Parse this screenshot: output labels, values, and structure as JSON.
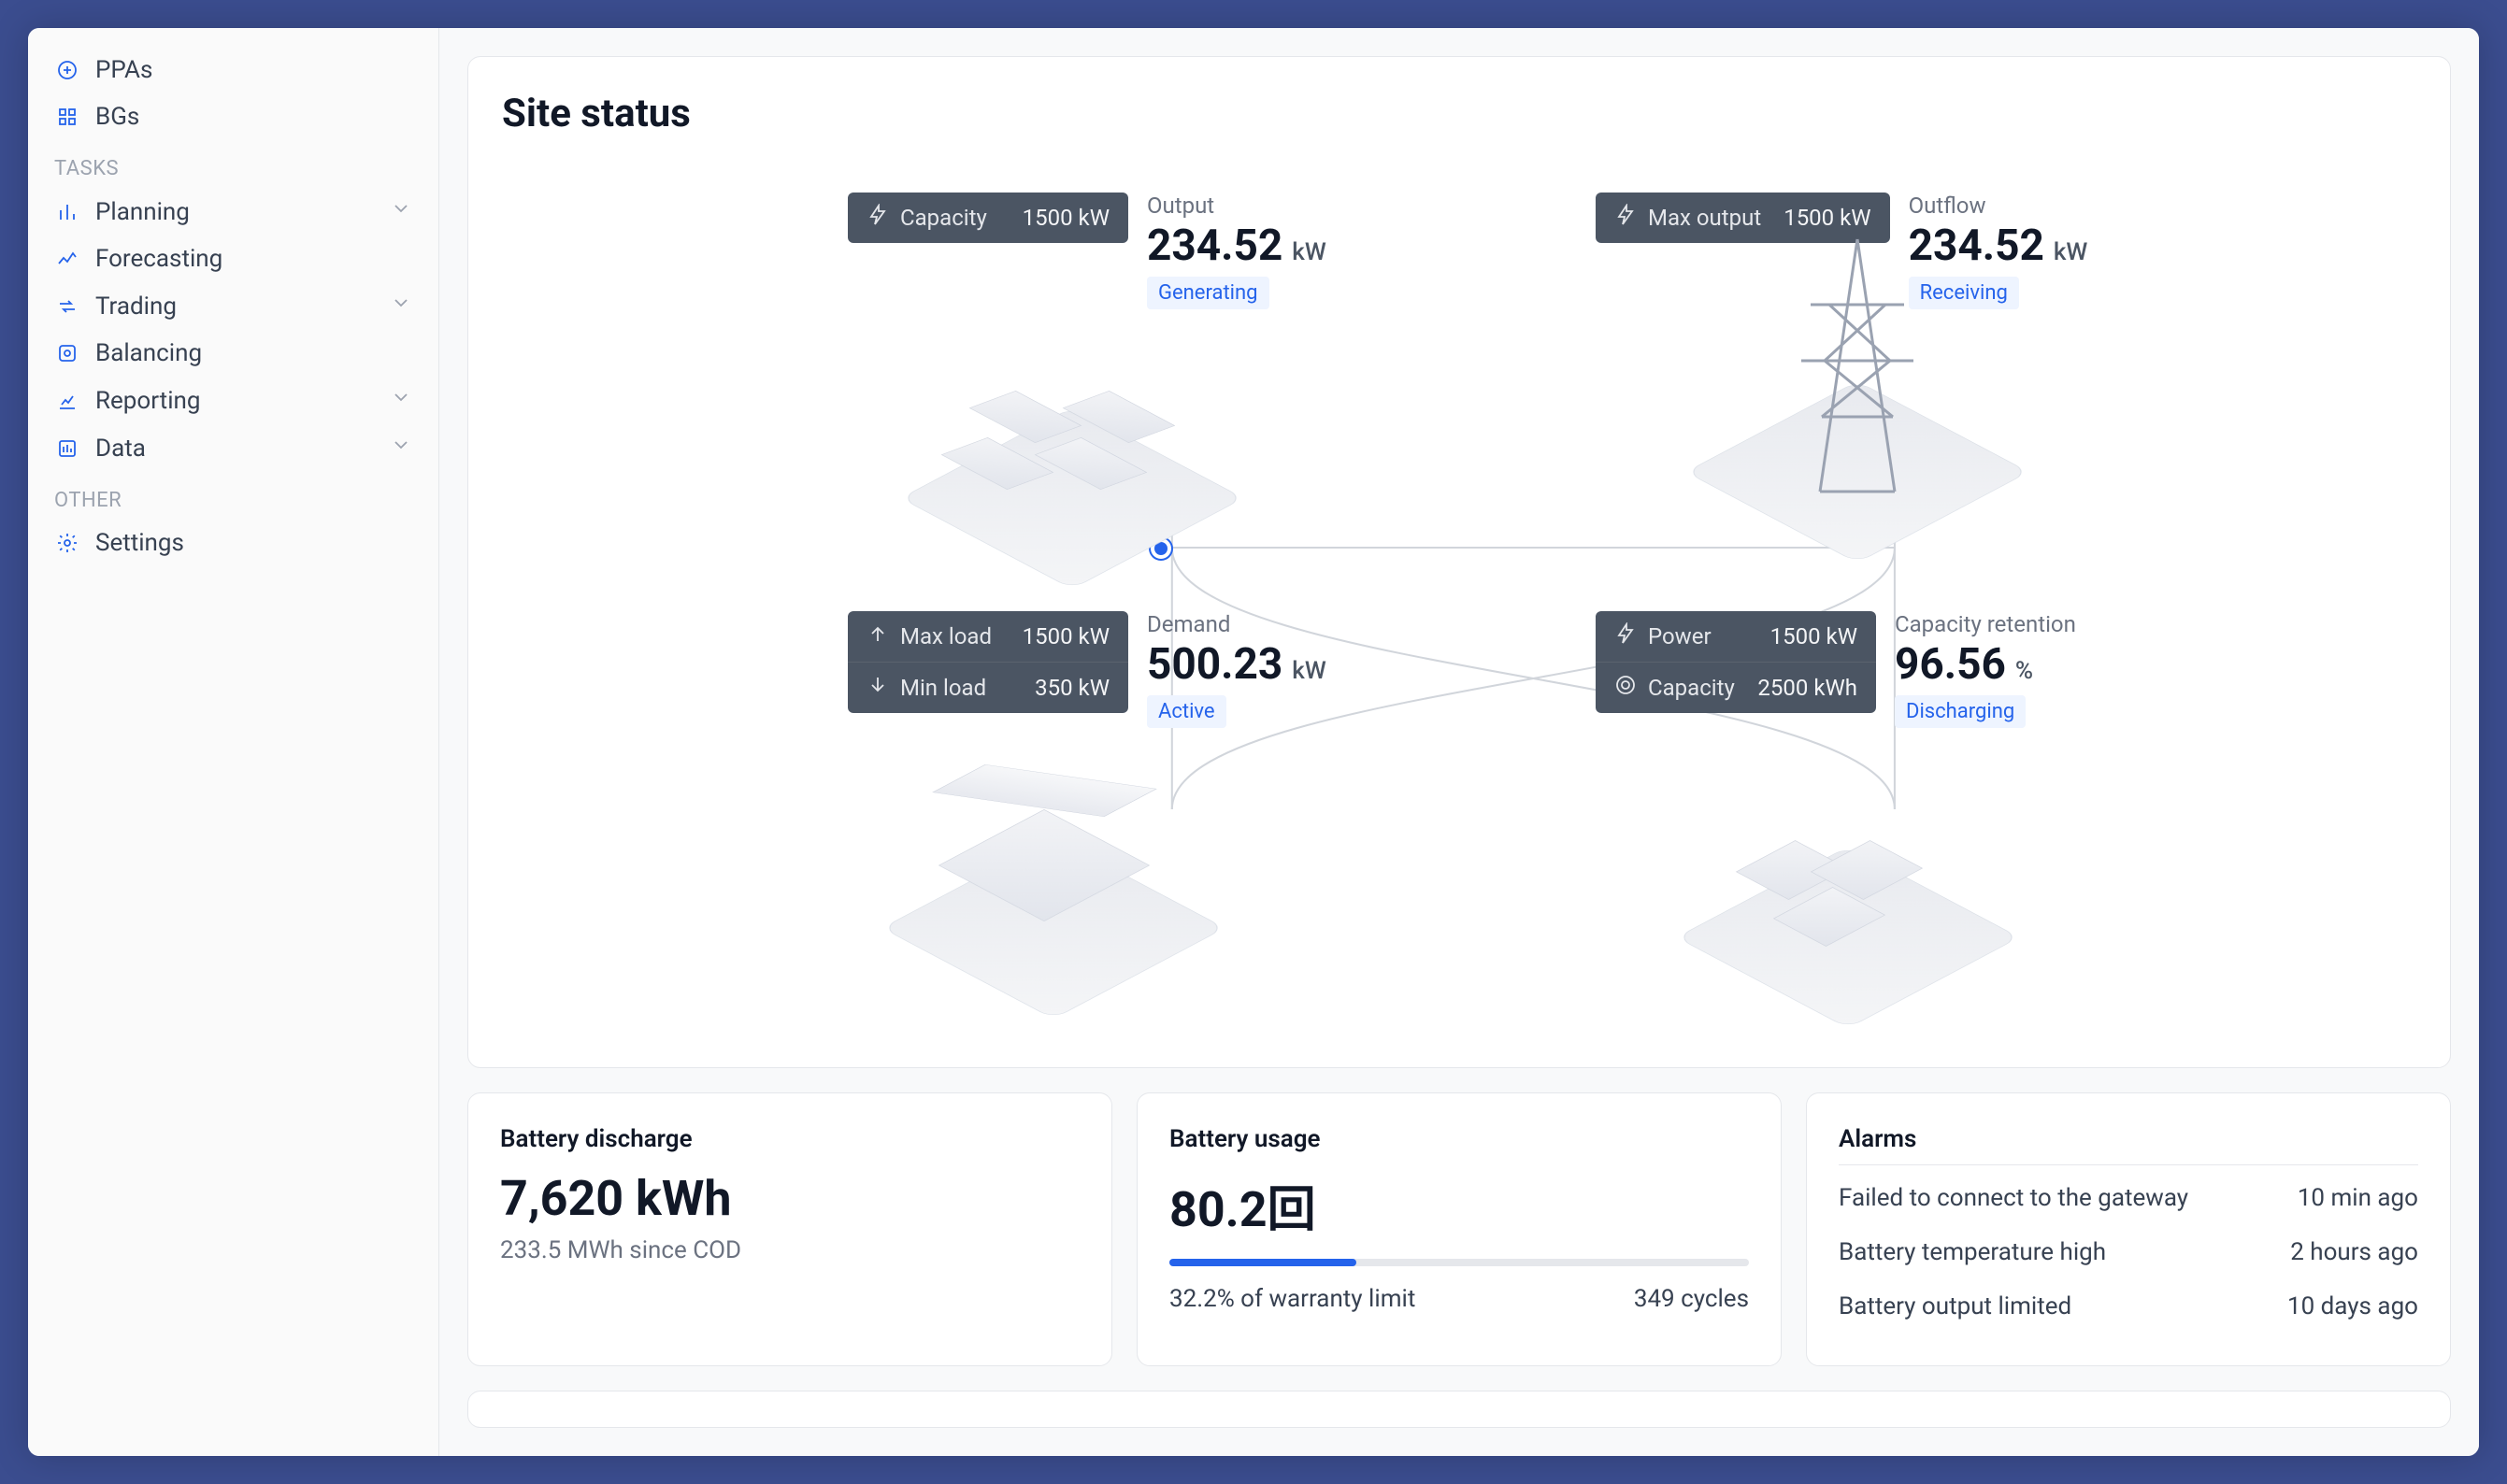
{
  "sidebar": {
    "top": [
      {
        "label": "PPAs",
        "icon": "generic"
      },
      {
        "label": "BGs",
        "icon": "grid"
      }
    ],
    "tasks_heading": "TASKS",
    "tasks": [
      {
        "label": "Planning",
        "expandable": true
      },
      {
        "label": "Forecasting",
        "expandable": false
      },
      {
        "label": "Trading",
        "expandable": true
      },
      {
        "label": "Balancing",
        "expandable": false
      },
      {
        "label": "Reporting",
        "expandable": true
      },
      {
        "label": "Data",
        "expandable": true
      }
    ],
    "other_heading": "OTHER",
    "other": [
      {
        "label": "Settings"
      }
    ]
  },
  "site": {
    "title": "Site status",
    "nodes": {
      "solar": {
        "tag_label": "Capacity",
        "tag_value": "1500 kW",
        "metric_label": "Output",
        "value": "234.52",
        "unit": "kW",
        "status": "Generating"
      },
      "grid": {
        "tag_label": "Max output",
        "tag_value": "1500 kW",
        "metric_label": "Outflow",
        "value": "234.52",
        "unit": "kW",
        "status": "Receiving"
      },
      "load": {
        "tag1_label": "Max load",
        "tag1_value": "1500 kW",
        "tag2_label": "Min load",
        "tag2_value": "350 kW",
        "metric_label": "Demand",
        "value": "500.23",
        "unit": "kW",
        "status": "Active"
      },
      "battery": {
        "tag1_label": "Power",
        "tag1_value": "1500 kW",
        "tag2_label": "Capacity",
        "tag2_value": "2500 kWh",
        "metric_label": "Capacity retention",
        "value": "96.56",
        "unit": "%",
        "status": "Discharging"
      }
    }
  },
  "bottom": {
    "discharge": {
      "title": "Battery discharge",
      "value": "7,620 kWh",
      "sub": "233.5 MWh since COD"
    },
    "usage": {
      "title": "Battery usage",
      "value": "80.2回",
      "progress_pct": 32.2,
      "limit_text": "32.2% of warranty limit",
      "cycles_text": "349 cycles"
    },
    "alarms": {
      "title": "Alarms",
      "items": [
        {
          "msg": "Failed to connect to the gateway",
          "time": "10 min ago"
        },
        {
          "msg": "Battery temperature high",
          "time": "2 hours ago"
        },
        {
          "msg": "Battery output limited",
          "time": "10 days ago"
        }
      ]
    }
  }
}
